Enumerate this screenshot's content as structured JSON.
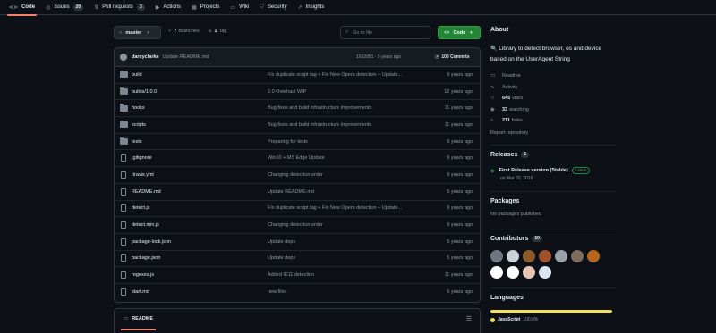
{
  "nav": {
    "tabs": [
      {
        "label": "Code",
        "icon": "code-icon",
        "count": null
      },
      {
        "label": "Issues",
        "icon": "issue-icon",
        "count": "20"
      },
      {
        "label": "Pull requests",
        "icon": "pull-request-icon",
        "count": "3"
      },
      {
        "label": "Actions",
        "icon": "play-icon",
        "count": null
      },
      {
        "label": "Projects",
        "icon": "table-icon",
        "count": null
      },
      {
        "label": "Wiki",
        "icon": "book-icon",
        "count": null
      },
      {
        "label": "Security",
        "icon": "shield-icon",
        "count": null
      },
      {
        "label": "Insights",
        "icon": "graph-icon",
        "count": null
      }
    ]
  },
  "branch": {
    "name": "master",
    "branches_count": "7",
    "branches_label": "Branches",
    "tags_count": "1",
    "tags_label": "Tag",
    "search_placeholder": "Go to file",
    "code_button": "Code"
  },
  "commit": {
    "author": "darcyclarke",
    "message": "Update README.md",
    "hash_age": "1692d51 · 5 years ago",
    "count": "100 Commits"
  },
  "files": [
    {
      "name": "build",
      "type": "folder",
      "message": "Fix duplicate script tag + Fix New Opera detection + Update...",
      "age": "9 years ago"
    },
    {
      "name": "builds/1.0.0",
      "type": "folder",
      "message": "2.0 Overhaul WIP",
      "age": "12 years ago"
    },
    {
      "name": "hooks",
      "type": "folder",
      "message": "Bug fixes and build infrastructure improvements.",
      "age": "11 years ago"
    },
    {
      "name": "scripts",
      "type": "folder",
      "message": "Bug fixes and build infrastructure improvements.",
      "age": "11 years ago"
    },
    {
      "name": "tests",
      "type": "folder",
      "message": "Preparing for tests",
      "age": "9 years ago"
    },
    {
      "name": ".gitignore",
      "type": "file",
      "message": "Win10 + MS Edge Update",
      "age": "9 years ago"
    },
    {
      "name": ".travis.yml",
      "type": "file",
      "message": "Changing detection order",
      "age": "9 years ago"
    },
    {
      "name": "README.md",
      "type": "file",
      "message": "Update README.md",
      "age": "5 years ago"
    },
    {
      "name": "detect.js",
      "type": "file",
      "message": "Fix duplicate script tag + Fix New Opera detection + Update...",
      "age": "9 years ago"
    },
    {
      "name": "detect.min.js",
      "type": "file",
      "message": "Changing detection order",
      "age": "9 years ago"
    },
    {
      "name": "package-lock.json",
      "type": "file",
      "message": "Update deps",
      "age": "5 years ago"
    },
    {
      "name": "package.json",
      "type": "file",
      "message": "Update deps",
      "age": "5 years ago"
    },
    {
      "name": "regexes.js",
      "type": "file",
      "message": "Added IE11 detection",
      "age": "11 years ago"
    },
    {
      "name": "start.md",
      "type": "file",
      "message": "new files",
      "age": "6 years ago"
    }
  ],
  "readme": {
    "label": "README"
  },
  "about": {
    "title": "About",
    "description_emoji": "🔍",
    "description": "Library to detect browser, os and device based on the UserAgent String",
    "links": [
      {
        "icon": "book-icon",
        "value": "",
        "label": "Readme"
      },
      {
        "icon": "pulse-icon",
        "value": "",
        "label": "Activity"
      },
      {
        "icon": "star-icon",
        "value": "645",
        "label": "stars"
      },
      {
        "icon": "eye-icon",
        "value": "33",
        "label": "watching"
      },
      {
        "icon": "fork-icon",
        "value": "211",
        "label": "forks"
      }
    ],
    "report": "Report repository"
  },
  "releases": {
    "title": "Releases",
    "count": "1",
    "name": "First Release version (Stable)",
    "badge": "Latest",
    "date": "on Mar 20, 2016"
  },
  "packages": {
    "title": "Packages",
    "empty": "No packages published"
  },
  "contributors": {
    "title": "Contributors",
    "count": "10",
    "avatar_colors": [
      "#6e7681",
      "#c9d1d9",
      "#8b5a2b",
      "#a0522d",
      "#9aa0a6",
      "#7d6b5d",
      "#b5651d",
      "#ffffff",
      "#ffffff",
      "#e6c3b3",
      "#d9e6f2"
    ]
  },
  "languages": {
    "title": "Languages",
    "items": [
      {
        "name": "JavaScript",
        "percent": "100.0%",
        "color": "#f1e05a"
      }
    ]
  }
}
